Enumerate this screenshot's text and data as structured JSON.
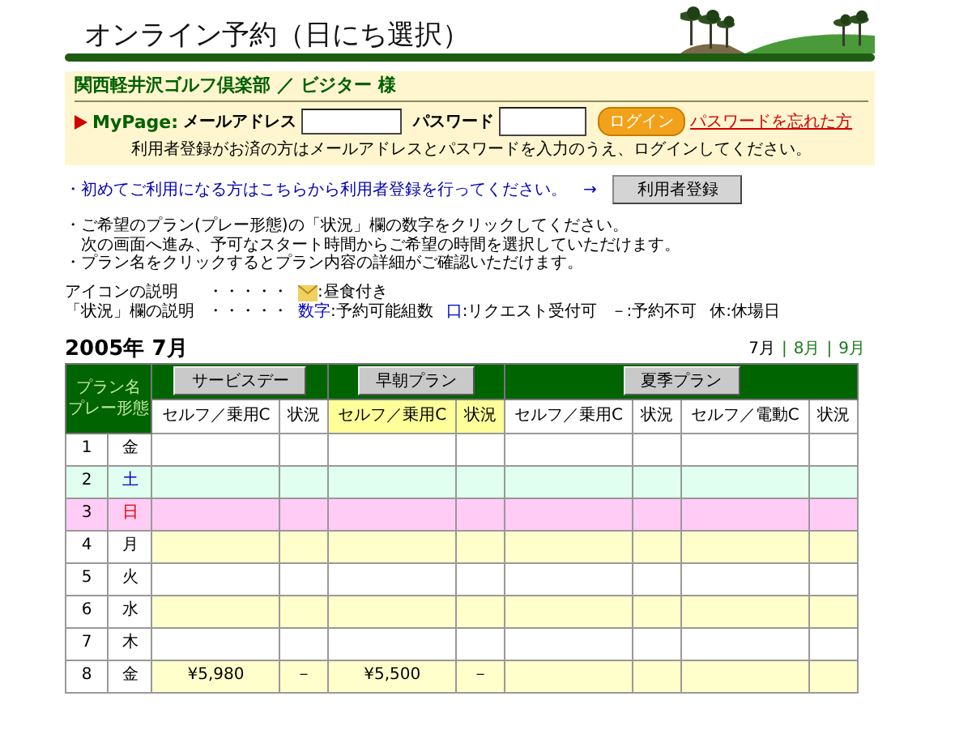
{
  "title": "オンライン予約（日にち選択）",
  "member": {
    "club": "関西軽井沢ゴルフ倶楽部 ／ ビジター 様",
    "mypage": "MyPage:",
    "email_label": "メールアドレス",
    "password_label": "パスワード",
    "login": "ログイン",
    "forgot": "パスワードを忘れた方",
    "note": "利用者登録がお済の方はメールアドレスとパスワードを入力のうえ、ログインしてください。"
  },
  "register": {
    "text": "・初めてご利用になる方はこちらから利用者登録を行ってください。",
    "arrow": "→",
    "button": "利用者登録"
  },
  "instructions": [
    "・ご希望のプラン(プレー形態)の「状況」欄の数字をクリックしてください。",
    "　次の画面へ進み、予可なスタート時間からご希望の時間を選択していただけます。",
    "・プラン名をクリックするとプラン内容の詳細がご確認いただけます。"
  ],
  "legend": [
    {
      "label": "アイコンの説明",
      "dots": "・・・・・",
      "kind": "icon",
      "items": [
        {
          "desc": ":昼食付き"
        }
      ]
    },
    {
      "label": "「状況」欄の説明",
      "dots": "・・・・・",
      "kind": "status",
      "items": [
        {
          "term": "数字",
          "desc": ":予約可能組数",
          "color": "#0000cc"
        },
        {
          "term": "口",
          "desc": ":リクエスト受付可",
          "color": "#0000cc"
        },
        {
          "term": "－",
          "desc": ":予約不可"
        },
        {
          "term": "休",
          "desc": ":休場日"
        }
      ]
    }
  ],
  "month_title": "2005年 7月",
  "month_separator": "|",
  "months": [
    {
      "label": "7月",
      "selected": true
    },
    {
      "label": "8月",
      "selected": false
    },
    {
      "label": "9月",
      "selected": false
    }
  ],
  "table": {
    "corner": [
      "プラン名",
      "プレー形態"
    ],
    "plans": [
      {
        "name": "サービスデー",
        "highlighted": false,
        "columns": [
          "セルフ／乗用C",
          "状況"
        ]
      },
      {
        "name": "早朝プラン",
        "highlighted": true,
        "columns": [
          "セルフ／乗用C",
          "状況"
        ]
      },
      {
        "name": "夏季プラン",
        "highlighted": false,
        "columns": [
          "セルフ／乗用C",
          "状況",
          "セルフ／電動C",
          "状況"
        ]
      }
    ],
    "rows": [
      {
        "date": "1",
        "day": "金",
        "kind": "white"
      },
      {
        "date": "2",
        "day": "土",
        "kind": "saturday"
      },
      {
        "date": "3",
        "day": "日",
        "kind": "sunday"
      },
      {
        "date": "4",
        "day": "月",
        "kind": "yellow"
      },
      {
        "date": "5",
        "day": "火",
        "kind": "white"
      },
      {
        "date": "6",
        "day": "水",
        "kind": "yellow"
      },
      {
        "date": "7",
        "day": "木",
        "kind": "white"
      },
      {
        "date": "8",
        "day": "金",
        "kind": "yellow",
        "cells": [
          "¥5,980",
          "－",
          "¥5,500",
          "－"
        ]
      }
    ]
  }
}
